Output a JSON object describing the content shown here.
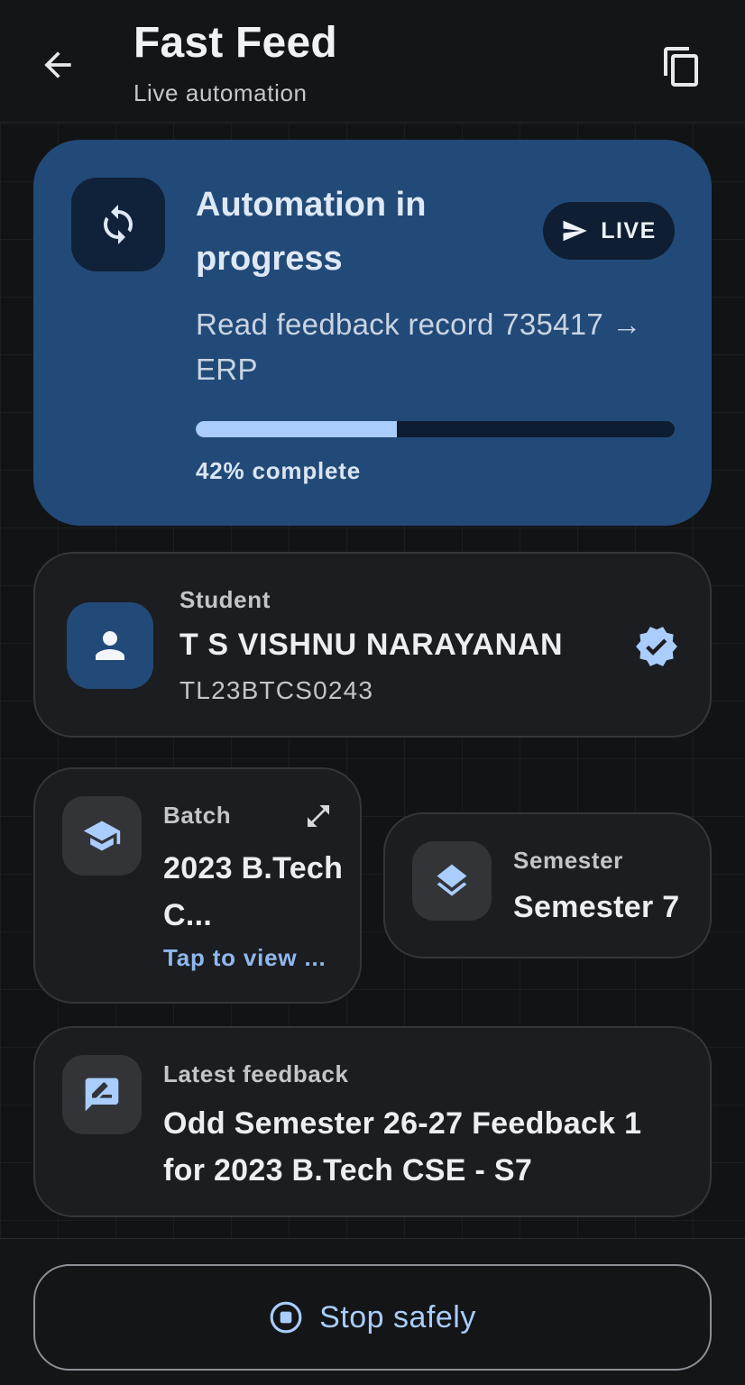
{
  "header": {
    "title": "Fast Feed",
    "subtitle": "Live automation"
  },
  "automation": {
    "title": "Automation in progress",
    "status_badge": "LIVE",
    "description": "Read feedback record 735417 → ERP",
    "progress_fraction": 0.42,
    "progress_label": "42% complete"
  },
  "student": {
    "label": "Student",
    "name": "T S VISHNU NARAYANAN",
    "id": "TL23BTCS0243"
  },
  "batch": {
    "label": "Batch",
    "value": "2023 B.Tech C...",
    "link": "Tap to view ..."
  },
  "semester": {
    "label": "Semester",
    "value": "Semester 7"
  },
  "feedback": {
    "label": "Latest feedback",
    "value": "Odd Semester 26-27 Feedback 1 for 2023 B.Tech CSE - S7"
  },
  "footer": {
    "stop_label": "Stop safely"
  },
  "colors": {
    "accent": "#a9cdfc",
    "card_primary": "#224a78",
    "background": "#111214"
  }
}
